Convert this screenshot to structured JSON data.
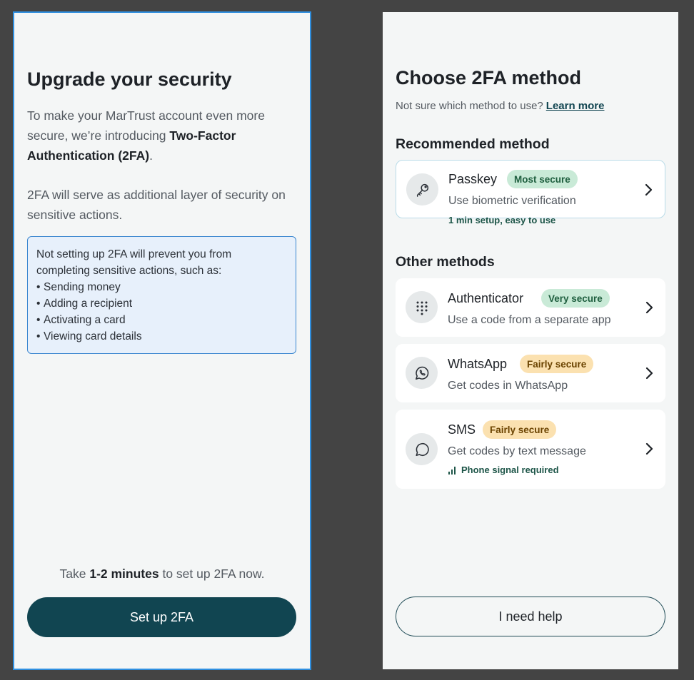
{
  "intro": {
    "title": "Upgrade your security",
    "para1_start": "To make your MarTrust account even more secure, we’re introducing ",
    "para1_bold": "Two-Factor Authentication (2FA)",
    "para1_end": ".",
    "para2": "2FA will serve as additional layer of security on sensitive actions.",
    "info_text": "Not setting up 2FA will prevent you from completing sensitive actions, such as:",
    "info_items": [
      "Sending money",
      "Adding a recipient",
      "Activating a card",
      "Viewing card details"
    ],
    "take_start": "Take ",
    "take_bold": "1-2 minutes",
    "take_end": " to set up 2FA now.",
    "setup_button": "Set up 2FA"
  },
  "chooser": {
    "title": "Choose 2FA method",
    "subtitle": "Not sure which method to use?",
    "learn_more": "Learn more",
    "recommended_heading": "Recommended method",
    "other_heading": "Other methods",
    "methods": [
      {
        "name": "Passkey",
        "badge": "Most secure",
        "badge_color": "#c9ead7",
        "desc": "Use biometric verification",
        "note": "1 min setup, easy to use",
        "icon": "key-icon"
      },
      {
        "name": "Authenticator",
        "badge": "Very secure",
        "badge_color": "#c9ead7",
        "desc": "Use a code from a separate app",
        "icon": "keypad-icon"
      },
      {
        "name": "WhatsApp",
        "badge": "Fairly secure",
        "badge_color": "#fbe1b0",
        "desc": "Get codes in WhatsApp",
        "icon": "whatsapp-icon"
      },
      {
        "name": "SMS",
        "badge": "Fairly secure",
        "badge_color": "#fbe1b0",
        "desc": "Get codes by text message",
        "note": "Phone signal required",
        "icon": "chat-bubble-icon"
      }
    ],
    "help_button": "I need help"
  },
  "colors": {
    "primary": "#114551",
    "info_border": "#3a86cf",
    "info_bg": "#e7f0fb",
    "selection_border": "#2f8fe0"
  }
}
